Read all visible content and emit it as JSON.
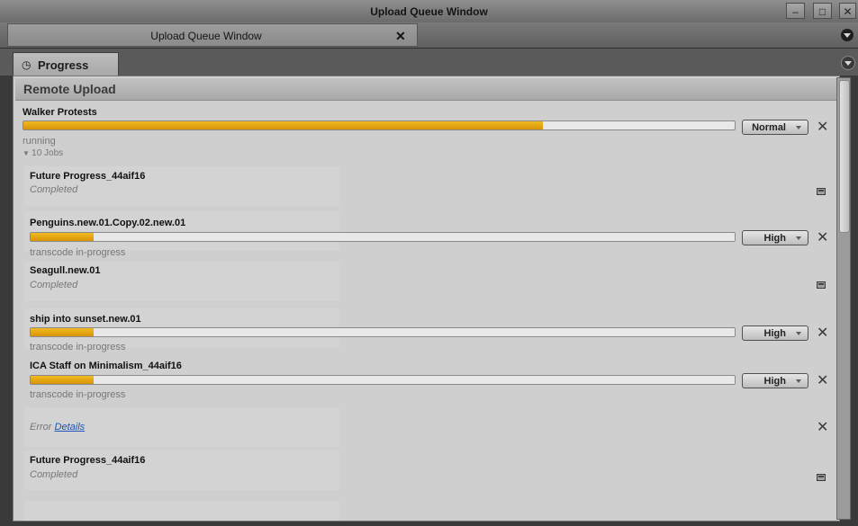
{
  "window": {
    "title": "Upload Queue Window"
  },
  "doc_tab": {
    "label": "Upload Queue Window"
  },
  "panel_tab": {
    "label": "Progress"
  },
  "section": {
    "title": "Remote Upload"
  },
  "main_job": {
    "name": "Walker Protests",
    "progress": 0.73,
    "priority": "Normal",
    "status": "running",
    "jobs_toggle": "10 Jobs"
  },
  "jobs": [
    {
      "name": "Future Progress_44aif16",
      "status": "Completed"
    },
    {
      "name": "Penguins.new.01.Copy.02.new.01",
      "status": "transcode in-progress",
      "progress": 0.09,
      "priority": "High"
    },
    {
      "name": "Seagull.new.01",
      "status": "Completed"
    },
    {
      "name": "ship into sunset.new.01",
      "status": "transcode in-progress",
      "progress": 0.09,
      "priority": "High"
    },
    {
      "name": "ICA Staff on Minimalism_44aif16",
      "status": "transcode in-progress",
      "progress": 0.09,
      "priority": "High"
    },
    {
      "error_label": "Error",
      "details_label": "Details"
    },
    {
      "name": "Future Progress_44aif16",
      "status": "Completed"
    }
  ],
  "colors": {
    "progress_fill": "#e0a010",
    "link": "#1e52b8"
  }
}
